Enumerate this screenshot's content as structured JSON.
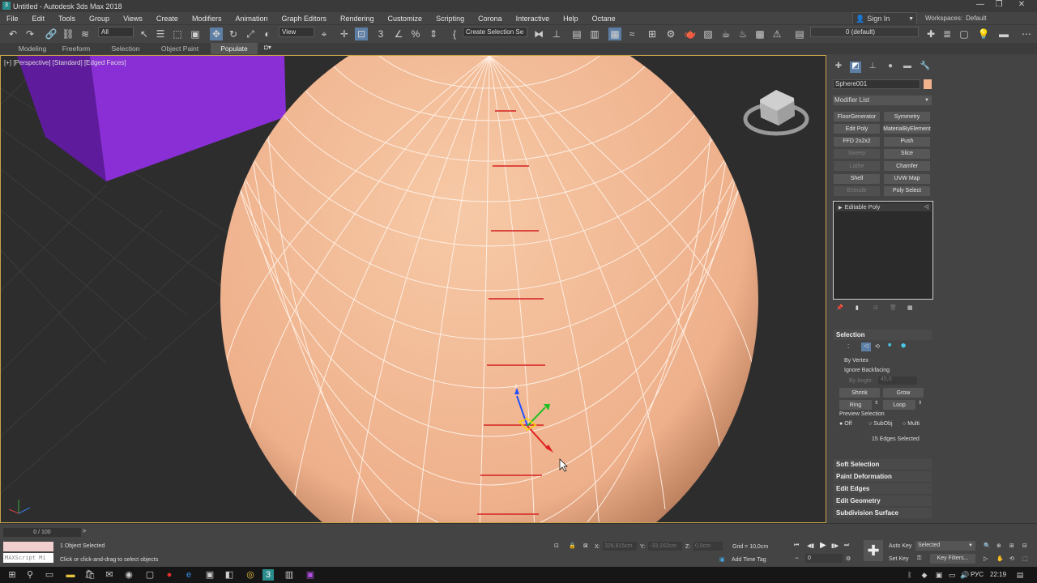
{
  "window": {
    "title": "Untitled - Autodesk 3ds Max 2018",
    "minimize": "—",
    "restore": "❐",
    "close": "✕"
  },
  "menu": [
    "File",
    "Edit",
    "Tools",
    "Group",
    "Views",
    "Create",
    "Modifiers",
    "Animation",
    "Graph Editors",
    "Rendering",
    "Customize",
    "Scripting",
    "Corona",
    "Interactive",
    "Help",
    "Octane"
  ],
  "account": {
    "sign_in": "Sign In",
    "workspaces_label": "Workspaces:",
    "workspace_value": "Default"
  },
  "toolbar": {
    "selection_filter": "All",
    "coord_system": "View",
    "named_selection_placeholder": "Create Selection Se",
    "layer": "0 (default)"
  },
  "ribbon_tabs": [
    "Modeling",
    "Freeform",
    "Selection",
    "Object Paint",
    "Populate"
  ],
  "viewport": {
    "label": "[+] [Perspective] [Standard] [Edged Faces]"
  },
  "command_panel": {
    "object_name": "Sphere001",
    "object_color": "#f2b48e",
    "modifier_list_label": "Modifier List",
    "modifier_buttons": [
      {
        "label": "FloorGenerator",
        "enabled": true
      },
      {
        "label": "Symmetry",
        "enabled": true
      },
      {
        "label": "Edit Poly",
        "enabled": true
      },
      {
        "label": "MaterialByElement",
        "enabled": true
      },
      {
        "label": "FFD 2x2x2",
        "enabled": true
      },
      {
        "label": "Push",
        "enabled": true
      },
      {
        "label": "Sweep",
        "enabled": false
      },
      {
        "label": "Slice",
        "enabled": true
      },
      {
        "label": "Lathe",
        "enabled": false
      },
      {
        "label": "Chamfer",
        "enabled": true
      },
      {
        "label": "Shell",
        "enabled": true
      },
      {
        "label": "UVW Map",
        "enabled": true
      },
      {
        "label": "Extrude",
        "enabled": false
      },
      {
        "label": "Poly Select",
        "enabled": true
      }
    ],
    "stack_item": "Editable Poly",
    "selection": {
      "title": "Selection",
      "by_vertex": "By Vertex",
      "ignore_backfacing": "Ignore Backfacing",
      "by_angle": "By Angle:",
      "by_angle_value": "45,0",
      "shrink": "Shrink",
      "grow": "Grow",
      "ring": "Ring",
      "loop": "Loop",
      "preview_selection": "Preview Selection",
      "preview_options": [
        "Off",
        "SubObj",
        "Multi"
      ],
      "status": "15 Edges Selected"
    },
    "rollouts": [
      "Soft Selection",
      "Paint Deformation",
      "Edit Edges",
      "Edit Geometry",
      "Subdivision Surface"
    ]
  },
  "bottom": {
    "frame_counter": "0 / 100",
    "maxscript": "MAXScript Mi",
    "status_main": "1 Object Selected",
    "status_prompt": "Click or click-and-drag to select objects",
    "x_label": "X:",
    "x_value": "328,815cm",
    "y_label": "Y:",
    "y_value": "-33,162cm",
    "z_label": "Z:",
    "z_value": "0,0cm",
    "grid": "Grid = 10,0cm",
    "add_time_tag": "Add Time Tag",
    "auto_key": "Auto Key",
    "set_key": "Set Key",
    "selected": "Selected",
    "key_filters": "Key Filters...",
    "current_frame": "0"
  },
  "taskbar": {
    "language": "РУС",
    "clock": "22:19"
  },
  "colors": {
    "accent": "#5d7fa6",
    "sphere": "#f2b48e",
    "box": "#8a2fd6",
    "selected_edge": "#d42020",
    "viewport_border": "#c9a24a"
  }
}
